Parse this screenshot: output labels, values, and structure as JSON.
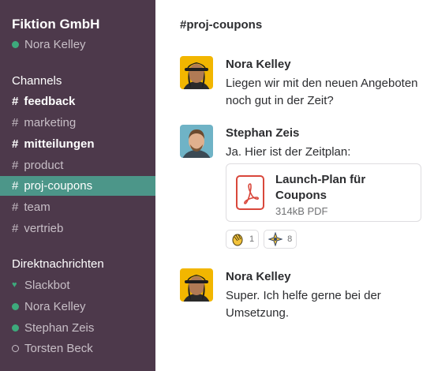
{
  "sidebar": {
    "team_name": "Fiktion GmbH",
    "current_user": "Nora Kelley",
    "channels_title": "Channels",
    "channels": [
      {
        "name": "feedback",
        "state": "unread"
      },
      {
        "name": "marketing",
        "state": "read"
      },
      {
        "name": "mitteilungen",
        "state": "unread"
      },
      {
        "name": "product",
        "state": "read"
      },
      {
        "name": "proj-coupons",
        "state": "active"
      },
      {
        "name": "team",
        "state": "read"
      },
      {
        "name": "vertrieb",
        "state": "read"
      }
    ],
    "dm_title": "Direktnachrichten",
    "dms": [
      {
        "name": "Slackbot",
        "presence": "heart-icon"
      },
      {
        "name": "Nora Kelley",
        "presence": "online"
      },
      {
        "name": "Stephan Zeis",
        "presence": "online"
      },
      {
        "name": "Torsten Beck",
        "presence": "offline"
      }
    ]
  },
  "channel": {
    "title": "#proj-coupons"
  },
  "messages": [
    {
      "author": "Nora Kelley",
      "text": "Liegen wir mit den neuen Angeboten noch gut in der Zeit?"
    },
    {
      "author": "Stephan Zeis",
      "text": "Ja. Hier ist der Zeitplan:",
      "file": {
        "name": "Launch-Plan für Coupons",
        "meta": "314kB PDF",
        "icon": "pdf-icon"
      },
      "reactions": [
        {
          "emoji": "clap-icon",
          "count": "1"
        },
        {
          "emoji": "sparkle-icon",
          "count": "8"
        }
      ]
    },
    {
      "author": "Nora Kelley",
      "text": "Super. Ich helfe gerne bei der Umsetzung."
    }
  ],
  "colors": {
    "sidebar_bg": "#4d394b",
    "active_channel": "#4c9689",
    "presence_online": "#3daa7c",
    "pdf_red": "#d9473b"
  }
}
